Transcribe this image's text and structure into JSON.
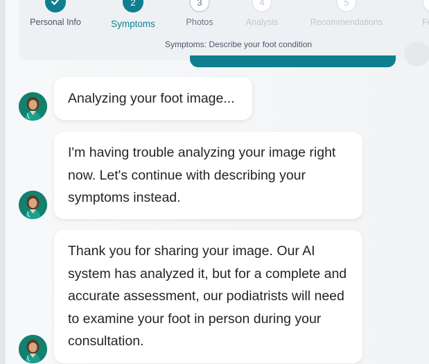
{
  "progress": {
    "steps": [
      {
        "number": "",
        "label": "Personal Info",
        "state": "done"
      },
      {
        "number": "2",
        "label": "Symptoms",
        "state": "current"
      },
      {
        "number": "3",
        "label": "Photos",
        "state": "upcoming"
      },
      {
        "number": "4",
        "label": "Analysis",
        "state": "future"
      },
      {
        "number": "5",
        "label": "Recommendations",
        "state": "future"
      },
      {
        "number": "",
        "label": "Foll",
        "state": "future"
      }
    ],
    "caption": "Symptoms: Describe your foot condition"
  },
  "messages": [
    {
      "sender": "assistant",
      "text": "Analyzing your foot image..."
    },
    {
      "sender": "assistant",
      "text": "I'm having trouble analyzing your image right now. Let's continue with describing your symptoms instead."
    },
    {
      "sender": "assistant",
      "text": "Thank you for sharing your image. Our AI system has analyzed it, but for a complete and accurate assessment, our podiatrists will need to examine your foot in person during your consultation."
    }
  ],
  "colors": {
    "accent": "#0f7f8f",
    "avatar_bg": "#14806e"
  },
  "icons": {
    "done_step": "checkmark-icon",
    "avatar": "assistant-avatar"
  }
}
